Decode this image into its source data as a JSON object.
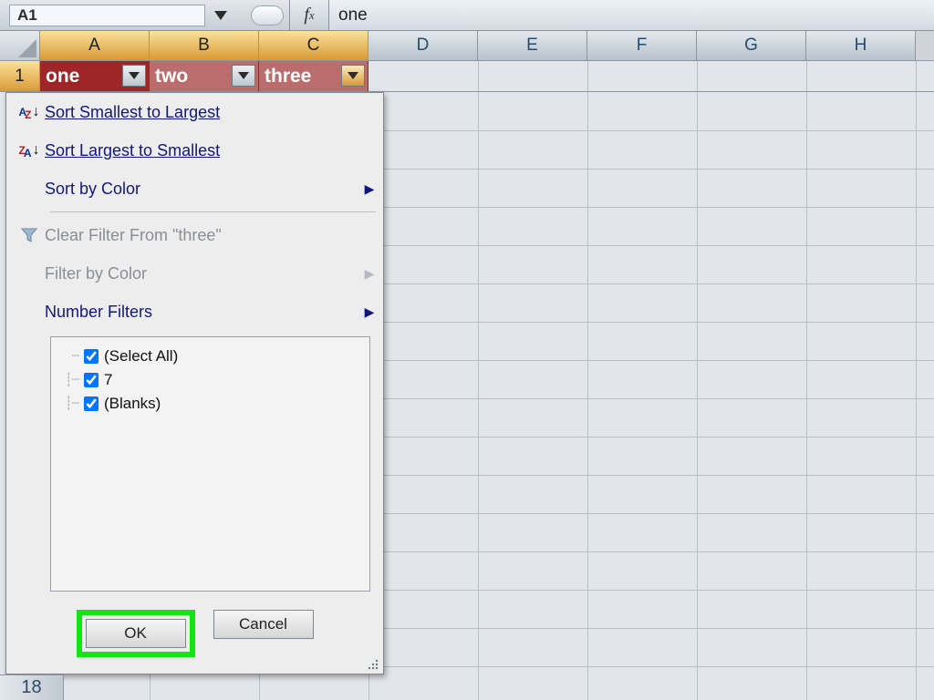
{
  "formula_bar": {
    "name_box": "A1",
    "fx_label": "f",
    "fx_sub": "x",
    "formula_value": "one"
  },
  "columns": [
    "A",
    "B",
    "C",
    "D",
    "E",
    "F",
    "G",
    "H"
  ],
  "selected_cols": [
    "A",
    "B",
    "C"
  ],
  "row1": {
    "row_number": "1",
    "headers": [
      {
        "label": "one",
        "style": "dark"
      },
      {
        "label": "two",
        "style": "light"
      },
      {
        "label": "three",
        "style": "light",
        "active": true
      }
    ]
  },
  "filter_menu": {
    "sort_asc": "Sort Smallest to Largest",
    "sort_desc": "Sort Largest to Smallest",
    "sort_color": "Sort by Color",
    "clear_filter": "Clear Filter From \"three\"",
    "filter_color": "Filter by Color",
    "number_filters": "Number Filters",
    "checks": {
      "select_all": "(Select All)",
      "item1": "7",
      "blanks": "(Blanks)"
    },
    "ok": "OK",
    "cancel": "Cancel"
  },
  "bottom_row_label": "18"
}
